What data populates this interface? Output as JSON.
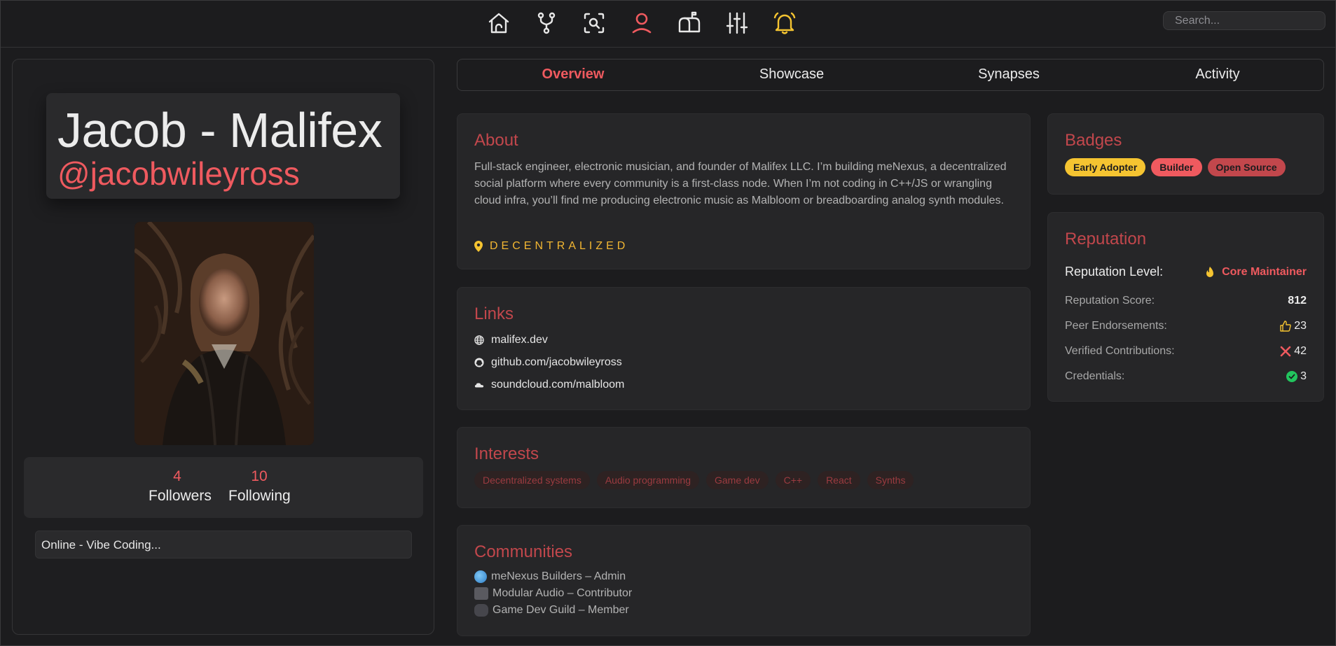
{
  "nav": {
    "icons": [
      "home-icon",
      "fork-icon",
      "scan-search-icon",
      "profile-icon",
      "mailbox-icon",
      "sliders-icon",
      "bell-icon"
    ],
    "active": "profile-icon",
    "search_placeholder": "Search..."
  },
  "profile": {
    "display_name": "Jacob - Malifex",
    "handle": "@jacobwileyross",
    "followers_count": "4",
    "followers_label": "Followers",
    "following_count": "10",
    "following_label": "Following",
    "status": "Online - Vibe Coding..."
  },
  "tabs": [
    "Overview",
    "Showcase",
    "Synapses",
    "Activity"
  ],
  "active_tab": "Overview",
  "about": {
    "title": "About",
    "text": "Full-stack engineer, electronic musician, and founder of Malifex LLC. I’m building meNexus, a decentralized social platform where every community is a first-class node. When I’m not coding in C++/JS or wrangling cloud infra, you’ll find me producing electronic music as Malbloom or breadboarding analog synth modules.",
    "location": "DECENTRALIZED"
  },
  "links": {
    "title": "Links",
    "items": [
      {
        "icon": "globe-icon",
        "label": "malifex.dev"
      },
      {
        "icon": "github-icon",
        "label": "github.com/jacobwileyross"
      },
      {
        "icon": "soundcloud-icon",
        "label": "soundcloud.com/malbloom"
      }
    ]
  },
  "interests": {
    "title": "Interests",
    "items": [
      "Decentralized systems",
      "Audio programming",
      "Game dev",
      "C++",
      "React",
      "Synths"
    ]
  },
  "communities": {
    "title": "Communities",
    "items": [
      {
        "icon": "globe-emoji-icon",
        "label": "meNexus Builders – Admin"
      },
      {
        "icon": "control-knobs-icon",
        "label": "Modular Audio – Contributor"
      },
      {
        "icon": "gamepad-icon",
        "label": "Game Dev Guild – Member"
      }
    ]
  },
  "badges": {
    "title": "Badges",
    "items": [
      {
        "label": "Early Adopter",
        "color": "#f5c431"
      },
      {
        "label": "Builder",
        "color": "#ef5a5f"
      },
      {
        "label": "Open Source",
        "color": "#c2474c"
      }
    ]
  },
  "reputation": {
    "title": "Reputation",
    "level_label": "Reputation Level:",
    "level_value": "Core Maintainer",
    "score_label": "Reputation Score:",
    "score_value": "812",
    "endorsements_label": "Peer Endorsements:",
    "endorsements_value": "23",
    "contributions_label": "Verified Contributions:",
    "contributions_value": "42",
    "credentials_label": "Credentials:",
    "credentials_value": "3"
  },
  "colors": {
    "accent": "#ef5a5f",
    "section_title": "#c2474c",
    "gold": "#f5c431",
    "success": "#22c55e",
    "background": "#1c1c1e",
    "card": "#262628"
  }
}
